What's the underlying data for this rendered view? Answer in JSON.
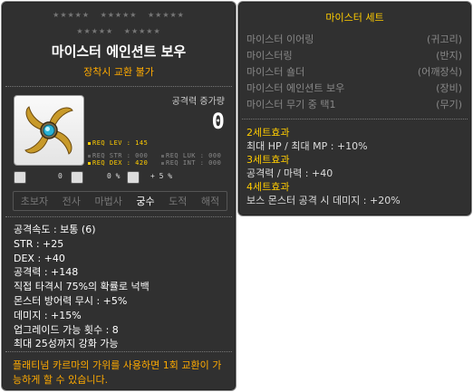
{
  "item": {
    "stars_row1": [
      "★★★★★",
      "★★★★★",
      "★★★★★"
    ],
    "stars_row2": [
      "★★★★★",
      "★★★★★"
    ],
    "name": "마이스터 에인션트 보우",
    "notice": "장착시 교환 불가",
    "attack_label": "공격력 증가량",
    "attack_value": "0",
    "req": {
      "lev": "REQ LEV : 145",
      "str": "REQ STR : 000",
      "luk": "REQ LUK : 000",
      "dex": "REQ DEX : 420",
      "int": "REQ INT : 000"
    },
    "mini": {
      "v1": "0",
      "v2": "0 %",
      "v3": "+ 5 %"
    },
    "jobs": [
      "초보자",
      "전사",
      "마법사",
      "궁수",
      "도적",
      "해적"
    ],
    "active_job": "궁수",
    "stats": [
      "공격속도 : 보통 (6)",
      "STR : +25",
      "DEX : +40",
      "공격력 : +148",
      "직접 타격시 75%의 확률로 넉백",
      "몬스터 방어력 무시 : +5%",
      "데미지 : +15%",
      "업그레이드 가능 횟수 : 8",
      "최대 25성까지 강화 가능"
    ],
    "footer": "플래티넘 카르마의 가위를 사용하면 1회 교환이 가능하게 할 수 있습니다.",
    "colors": {
      "accent": "#ffaa00",
      "req_met": "#ffcc00",
      "req_unmet": "#8a8a8a"
    },
    "icon": "ancient-bow-icon"
  },
  "set": {
    "title": "마이스터 세트",
    "items": [
      {
        "name": "마이스터 이어링",
        "slot": "(귀고리)"
      },
      {
        "name": "마이스터링",
        "slot": "(반지)"
      },
      {
        "name": "마이스터 숄더",
        "slot": "(어깨장식)"
      },
      {
        "name": "마이스터 에인션트 보우",
        "slot": "(장비)"
      },
      {
        "name": "마이스터 무기 중 택1",
        "slot": "(무기)"
      }
    ],
    "effects": [
      {
        "head": "2세트효과",
        "lines": [
          "최대 HP / 최대 MP : +10%"
        ]
      },
      {
        "head": "3세트효과",
        "lines": [
          "공격력 / 마력 : +40"
        ]
      },
      {
        "head": "4세트효과",
        "lines": [
          "보스 몬스터 공격 시 데미지 : +20%"
        ]
      }
    ]
  }
}
